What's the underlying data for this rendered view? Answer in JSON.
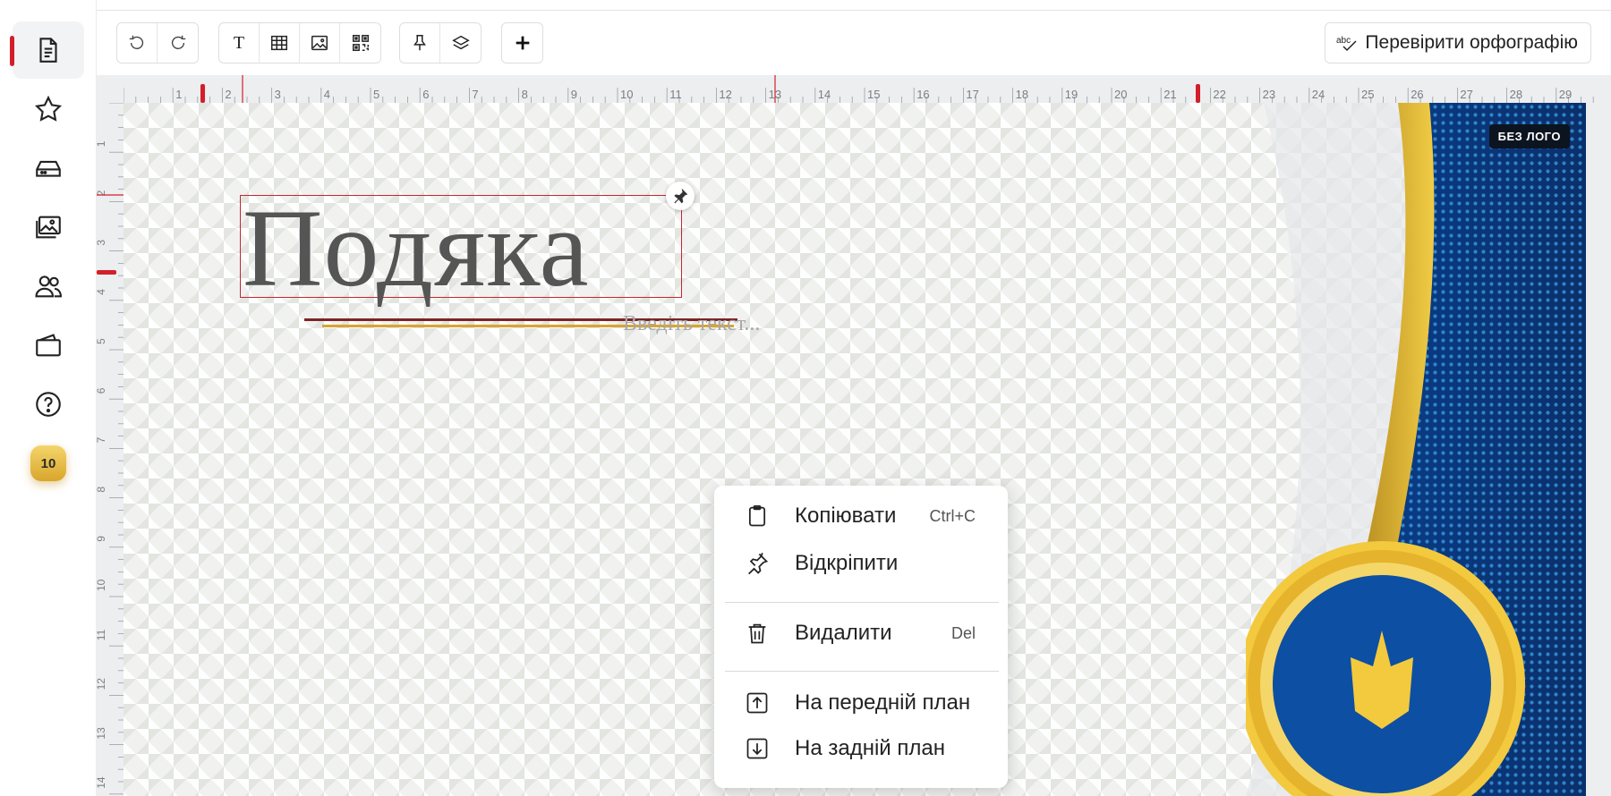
{
  "sidebar": {
    "items": [
      {
        "name": "document-icon",
        "active": true
      },
      {
        "name": "star-icon"
      },
      {
        "name": "drive-icon"
      },
      {
        "name": "images-icon"
      },
      {
        "name": "users-icon"
      },
      {
        "name": "wallet-icon"
      },
      {
        "name": "help-icon"
      }
    ],
    "badge": "10"
  },
  "toolbar": {
    "text_glyph": "T",
    "spellcheck_label": "Перевірити орфографію"
  },
  "ruler": {
    "horizontal": [
      "1",
      "2",
      "3",
      "4",
      "5",
      "6",
      "7",
      "8",
      "9",
      "10",
      "11",
      "12",
      "13",
      "14",
      "15",
      "16",
      "17",
      "18",
      "19",
      "20",
      "21",
      "22",
      "23",
      "24",
      "25",
      "26",
      "27",
      "28",
      "29"
    ],
    "vertical": [
      "1",
      "2",
      "3",
      "4",
      "5",
      "6",
      "7",
      "8",
      "9",
      "10",
      "11",
      "12",
      "13",
      "14"
    ]
  },
  "canvas": {
    "title": "Подяка",
    "placeholder": "Введіть текст...",
    "logo_badge": "БЕЗ ЛОГО"
  },
  "context_menu": {
    "items": [
      {
        "icon": "clipboard-icon",
        "label": "Копіювати",
        "shortcut": "Ctrl+C"
      },
      {
        "icon": "pin-icon",
        "label": "Відкріпити",
        "shortcut": ""
      },
      {
        "icon": "trash-icon",
        "label": "Видалити",
        "shortcut": "Del"
      },
      {
        "icon": "bring-front-icon",
        "label": "На передній план",
        "shortcut": ""
      },
      {
        "icon": "send-back-icon",
        "label": "На задній план",
        "shortcut": ""
      }
    ]
  },
  "colors": {
    "accent": "#d21f2a",
    "deco_blue": "#0d4fa3",
    "deco_gold": "#e6b32c"
  }
}
